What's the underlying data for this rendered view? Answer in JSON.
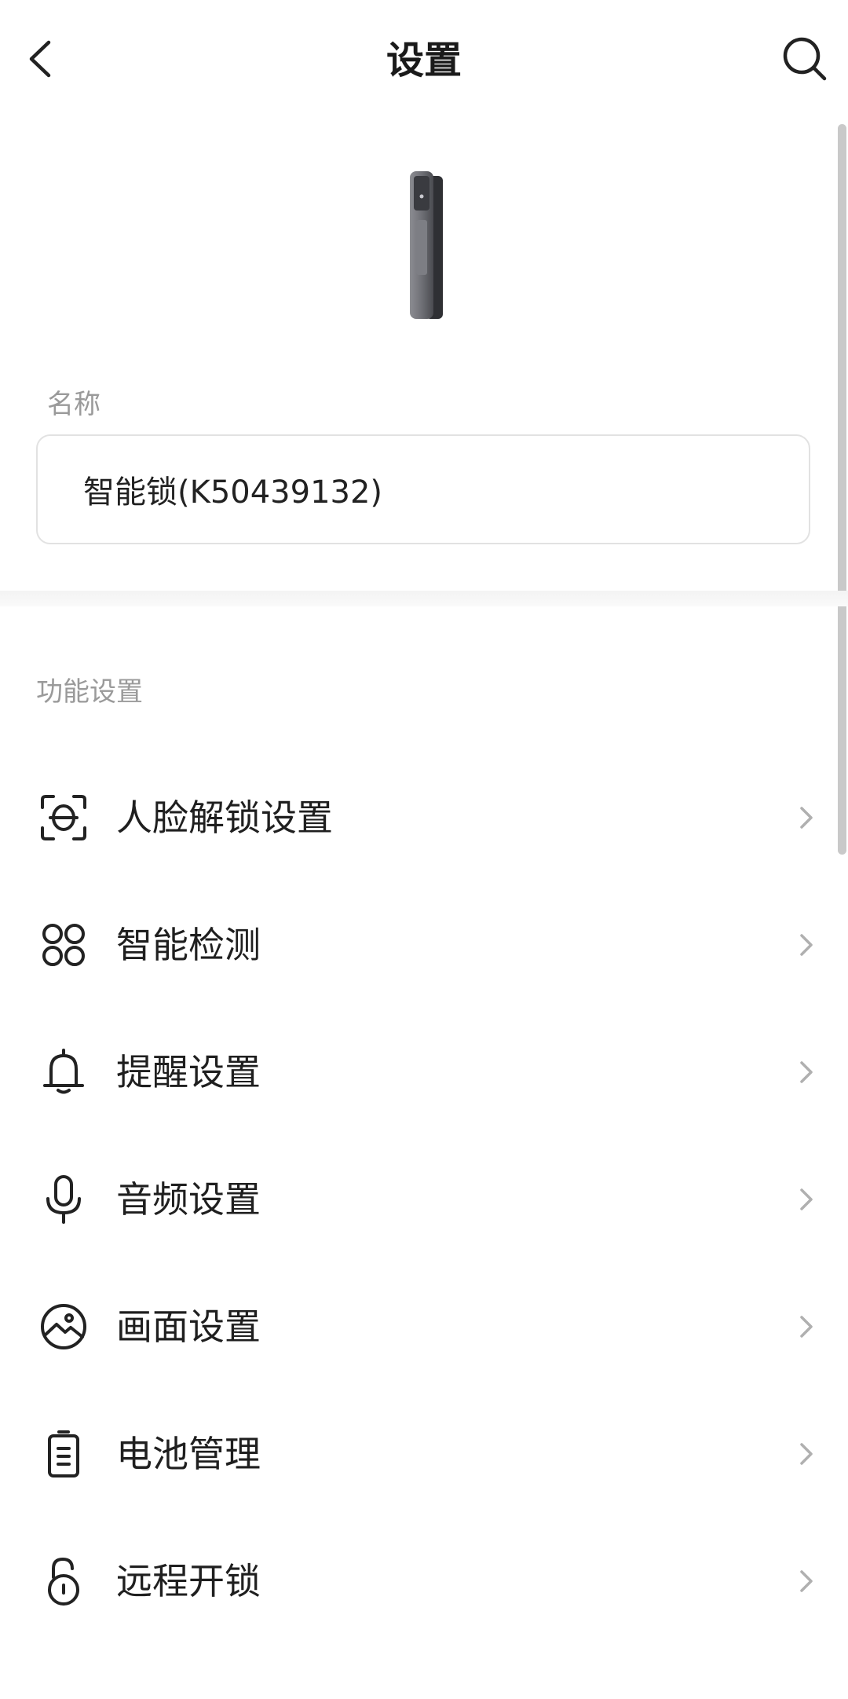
{
  "header": {
    "title": "设置",
    "back_icon": "chevron-left-icon",
    "search_icon": "search-icon"
  },
  "device": {
    "image": "smart-lock-device",
    "name_label": "名称",
    "name_value": "智能锁(K50439132)"
  },
  "section": {
    "title": "功能设置"
  },
  "menu": [
    {
      "label": "人脸解锁设置",
      "icon": "face-scan-icon"
    },
    {
      "label": "智能检测",
      "icon": "four-circles-icon"
    },
    {
      "label": "提醒设置",
      "icon": "bell-icon"
    },
    {
      "label": "音频设置",
      "icon": "microphone-icon"
    },
    {
      "label": "画面设置",
      "icon": "picture-icon"
    },
    {
      "label": "电池管理",
      "icon": "battery-icon"
    },
    {
      "label": "远程开锁",
      "icon": "unlock-icon"
    }
  ],
  "colors": {
    "text": "#1f1f1f",
    "secondary_text": "#9a9a9a",
    "border": "#e2e2e2",
    "chevron": "#b0b0b0"
  }
}
